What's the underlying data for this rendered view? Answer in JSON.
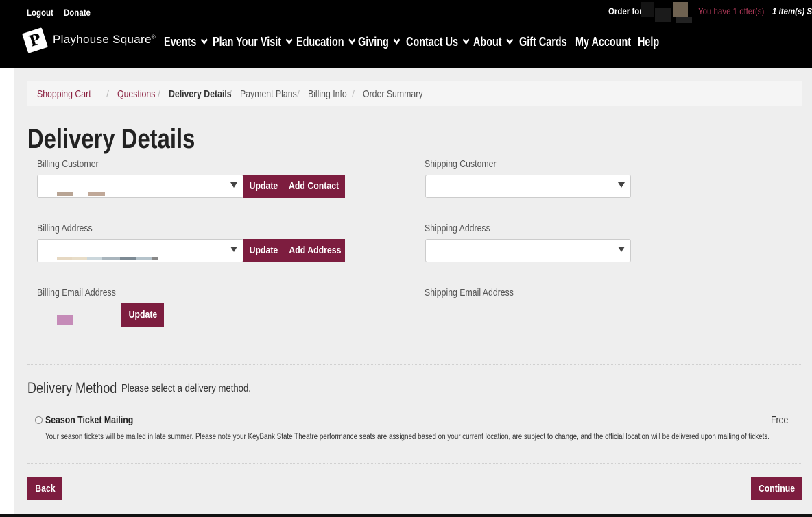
{
  "utility": {
    "logout": "Logout",
    "donate": "Donate",
    "order_for": "Order for",
    "offers": "You have 1 offer(s)",
    "items": "1 item(s) S"
  },
  "logo": {
    "name": "Playhouse Square",
    "registered": "®"
  },
  "nav": {
    "events": "Events",
    "plan_visit": "Plan Your Visit",
    "education": "Education",
    "giving": "Giving",
    "contact": "Contact Us",
    "about": "About",
    "gift_cards": "Gift Cards",
    "account": "My Account",
    "help": "Help"
  },
  "breadcrumb": {
    "cart": "Shopping Cart",
    "questions": "Questions",
    "delivery": "Delivery Details",
    "payment": "Payment Plans",
    "billing": "Billing Info",
    "summary": "Order Summary",
    "separator": "/"
  },
  "page_title": "Delivery Details",
  "billing": {
    "customer_label": "Billing Customer",
    "address_label": "Billing Address",
    "email_label": "Billing Email Address",
    "update": "Update",
    "add_contact": "Add Contact",
    "add_address": "Add Address"
  },
  "shipping": {
    "customer_label": "Shipping Customer",
    "address_label": "Shipping Address",
    "email_label": "Shipping Email Address"
  },
  "delivery": {
    "title": "Delivery Method",
    "prompt": "Please select a delivery method.",
    "option_name": "Season Ticket Mailing",
    "option_price": "Free",
    "option_desc": "Your season tickets will be mailed in late summer. Please note your KeyBank State Theatre performance seats are assigned based on your current location, are subject to change, and the official location will be delivered upon mailing of tickets."
  },
  "footer": {
    "back": "Back",
    "continue": "Continue"
  },
  "colors": {
    "brand": "#7d1d3f",
    "link": "#8a1f3f",
    "offer": "#b33a5a"
  }
}
